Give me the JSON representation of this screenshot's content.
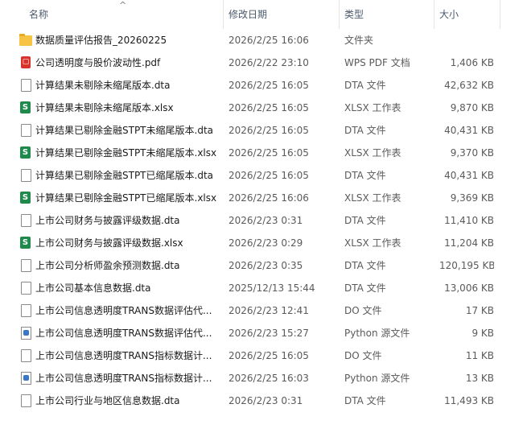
{
  "columns": {
    "name": "名称",
    "date": "修改日期",
    "type": "类型",
    "size": "大小",
    "sort_indicator": "^"
  },
  "files": [
    {
      "icon": "folder-icon",
      "name": "数据质量评估报告_20260225",
      "date": "2026/2/25 16:06",
      "type": "文件夹",
      "size": ""
    },
    {
      "icon": "pdf-icon",
      "name": "公司透明度与股价波动性.pdf",
      "date": "2026/2/22 23:10",
      "type": "WPS PDF 文档",
      "size": "1,406 KB"
    },
    {
      "icon": "dta-file-icon",
      "name": "计算结果未剔除未缩尾版本.dta",
      "date": "2026/2/25 16:05",
      "type": "DTA 文件",
      "size": "42,632 KB"
    },
    {
      "icon": "xlsx-icon",
      "name": "计算结果未剔除未缩尾版本.xlsx",
      "date": "2026/2/25 16:05",
      "type": "XLSX 工作表",
      "size": "9,870 KB"
    },
    {
      "icon": "dta-file-icon",
      "name": "计算结果已剔除金融STPT未缩尾版本.dta",
      "date": "2026/2/25 16:05",
      "type": "DTA 文件",
      "size": "40,431 KB"
    },
    {
      "icon": "xlsx-icon",
      "name": "计算结果已剔除金融STPT未缩尾版本.xlsx",
      "date": "2026/2/25 16:05",
      "type": "XLSX 工作表",
      "size": "9,370 KB"
    },
    {
      "icon": "dta-file-icon",
      "name": "计算结果已剔除金融STPT已缩尾版本.dta",
      "date": "2026/2/25 16:05",
      "type": "DTA 文件",
      "size": "40,431 KB"
    },
    {
      "icon": "xlsx-icon",
      "name": "计算结果已剔除金融STPT已缩尾版本.xlsx",
      "date": "2026/2/25 16:06",
      "type": "XLSX 工作表",
      "size": "9,369 KB"
    },
    {
      "icon": "dta-file-icon",
      "name": "上市公司财务与披露评级数据.dta",
      "date": "2026/2/23 0:31",
      "type": "DTA 文件",
      "size": "11,410 KB"
    },
    {
      "icon": "xlsx-icon",
      "name": "上市公司财务与披露评级数据.xlsx",
      "date": "2026/2/23 0:29",
      "type": "XLSX 工作表",
      "size": "11,204 KB"
    },
    {
      "icon": "dta-file-icon",
      "name": "上市公司分析师盈余预测数据.dta",
      "date": "2026/2/23 0:35",
      "type": "DTA 文件",
      "size": "120,195 KB"
    },
    {
      "icon": "dta-file-icon",
      "name": "上市公司基本信息数据.dta",
      "date": "2025/12/13 15:44",
      "type": "DTA 文件",
      "size": "13,006 KB"
    },
    {
      "icon": "do-file-icon",
      "name": "上市公司信息透明度TRANS数据评估代...",
      "date": "2026/2/23 12:41",
      "type": "DO 文件",
      "size": "17 KB"
    },
    {
      "icon": "python-file-icon",
      "name": "上市公司信息透明度TRANS数据评估代...",
      "date": "2026/2/23 15:27",
      "type": "Python 源文件",
      "size": "9 KB"
    },
    {
      "icon": "do-file-icon",
      "name": "上市公司信息透明度TRANS指标数据计...",
      "date": "2026/2/25 16:05",
      "type": "DO 文件",
      "size": "11 KB"
    },
    {
      "icon": "python-file-icon",
      "name": "上市公司信息透明度TRANS指标数据计...",
      "date": "2026/2/25 16:03",
      "type": "Python 源文件",
      "size": "13 KB"
    },
    {
      "icon": "dta-file-icon",
      "name": "上市公司行业与地区信息数据.dta",
      "date": "2026/2/23 0:31",
      "type": "DTA 文件",
      "size": "11,493 KB"
    }
  ]
}
